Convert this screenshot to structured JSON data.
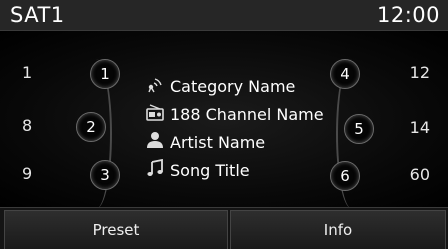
{
  "status": {
    "band": "SAT1",
    "time": "12:00"
  },
  "presets_left": [
    {
      "freq": "1",
      "num": "1"
    },
    {
      "freq": "8",
      "num": "2"
    },
    {
      "freq": "9",
      "num": "3"
    }
  ],
  "presets_right": [
    {
      "freq": "12",
      "num": "4"
    },
    {
      "freq": "14",
      "num": "5"
    },
    {
      "freq": "60",
      "num": "6"
    }
  ],
  "info": {
    "category": "Category Name",
    "channel": "188 Channel Name",
    "artist": "Artist Name",
    "song": "Song Title"
  },
  "softkeys": {
    "preset": "Preset",
    "info": "Info"
  },
  "icons": [
    "antenna-icon",
    "radio-icon",
    "person-icon",
    "music-note-icon"
  ]
}
